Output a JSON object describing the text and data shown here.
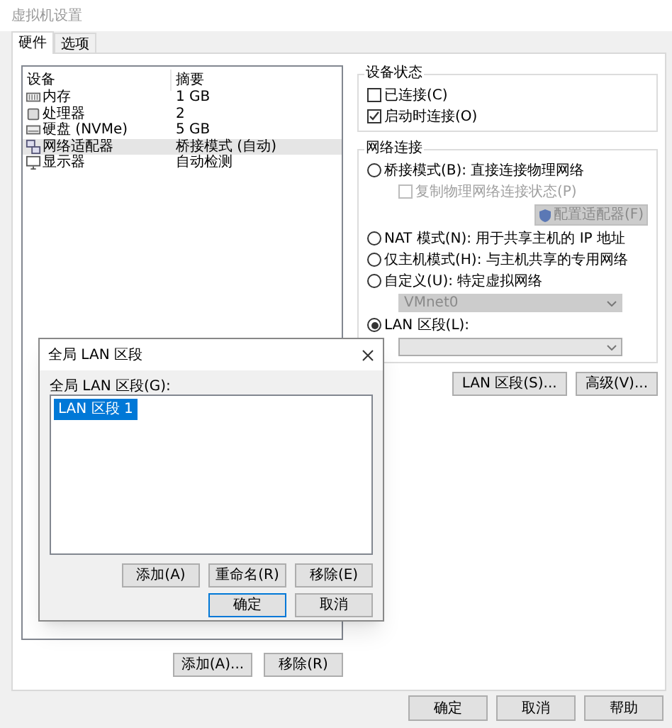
{
  "window": {
    "title": "虚拟机设置"
  },
  "tabs": [
    {
      "label": "硬件",
      "selected": true
    },
    {
      "label": "选项",
      "selected": false
    }
  ],
  "device_list": {
    "columns": [
      "设备",
      "摘要"
    ],
    "rows": [
      {
        "kind": "memory",
        "device": "内存",
        "summary": "1 GB",
        "selected": false
      },
      {
        "kind": "cpu",
        "device": "处理器",
        "summary": "2",
        "selected": false
      },
      {
        "kind": "disk",
        "device": "硬盘 (NVMe)",
        "summary": "5 GB",
        "selected": false
      },
      {
        "kind": "network",
        "device": "网络适配器",
        "summary": "桥接模式 (自动)",
        "selected": true
      },
      {
        "kind": "display",
        "device": "显示器",
        "summary": "自动检测",
        "selected": false
      }
    ]
  },
  "list_buttons": [
    "添加(A)...",
    "移除(R)"
  ],
  "device_status": {
    "title": "设备状态",
    "checkboxes": [
      {
        "label": "已连接(C)",
        "checked": false
      },
      {
        "label": "启动时连接(O)",
        "checked": true
      }
    ]
  },
  "network": {
    "title": "网络连接",
    "items": [
      {
        "kind": "radio",
        "label": "桥接模式(B): 直接连接物理网络",
        "selected": false
      },
      {
        "kind": "checkbox",
        "label": "复制物理网络连接状态(P)",
        "checked": false,
        "disabled": true
      },
      {
        "kind": "button",
        "label": "配置适配器(F)",
        "disabled": true
      },
      {
        "kind": "radio",
        "label": "NAT 模式(N): 用于共享主机的 IP 地址",
        "selected": false
      },
      {
        "kind": "radio",
        "label": "仅主机模式(H): 与主机共享的专用网络",
        "selected": false
      },
      {
        "kind": "radio",
        "label": "自定义(U): 特定虚拟网络",
        "selected": false
      },
      {
        "kind": "select",
        "value": "VMnet0",
        "disabled": true
      },
      {
        "kind": "radio",
        "label": "LAN 区段(L):",
        "selected": true
      },
      {
        "kind": "select",
        "disabled": false
      }
    ]
  },
  "network_buttons": [
    "LAN 区段(S)...",
    "高级(V)..."
  ],
  "footer_buttons": [
    "确定",
    "取消",
    "帮助"
  ],
  "dialog": {
    "title": "全局 LAN 区段",
    "list_label": "全局 LAN 区段(G):",
    "items": [
      {
        "label": "LAN 区段 1",
        "selected": true
      }
    ],
    "buttons": [
      "添加(A)",
      "重命名(R)",
      "移除(E)"
    ],
    "confirm_buttons": [
      {
        "label": "确定",
        "default": true
      },
      {
        "label": "取消",
        "default": false
      }
    ]
  }
}
